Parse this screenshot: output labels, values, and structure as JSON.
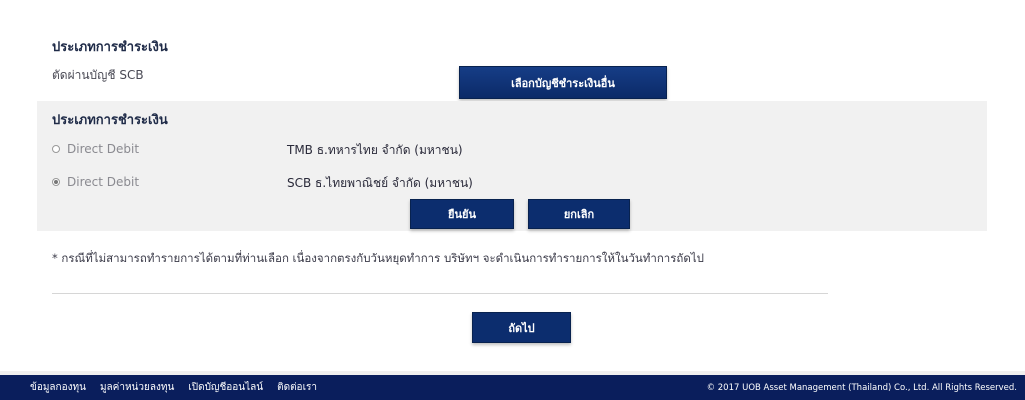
{
  "account_section": {
    "title": "ประเภทการชำระเงิน",
    "current_account": "ตัดผ่านบัญชี SCB",
    "change_button": "เลือกบัญชีชำระเงินอื่น"
  },
  "payment_panel": {
    "title": "ประเภทการชำระเงิน",
    "options": [
      {
        "type": "Direct Debit",
        "bank": "TMB ธ.ทหารไทย จำกัด (มหาชน)",
        "selected": false
      },
      {
        "type": "Direct Debit",
        "bank": "SCB ธ.ไทยพาณิชย์ จำกัด (มหาชน)",
        "selected": true
      }
    ],
    "confirm_button": "ยืนยัน",
    "cancel_button": "ยกเลิก"
  },
  "note": "* กรณีที่ไม่สามารถทำรายการได้ตามที่ท่านเลือก เนื่องจากตรงกับวันหยุดทำการ บริษัทฯ จะดำเนินการทำรายการให้ในวันทำการถัดไป",
  "next_button": "ถัดไป",
  "footer": {
    "links": [
      "ข้อมูลกองทุน",
      "มูลค่าหน่วยลงทุน",
      "เปิดบัญชีออนไลน์",
      "ติดต่อเรา"
    ],
    "copyright": "© 2017 UOB Asset Management (Thailand) Co., Ltd. All Rights Reserved."
  }
}
